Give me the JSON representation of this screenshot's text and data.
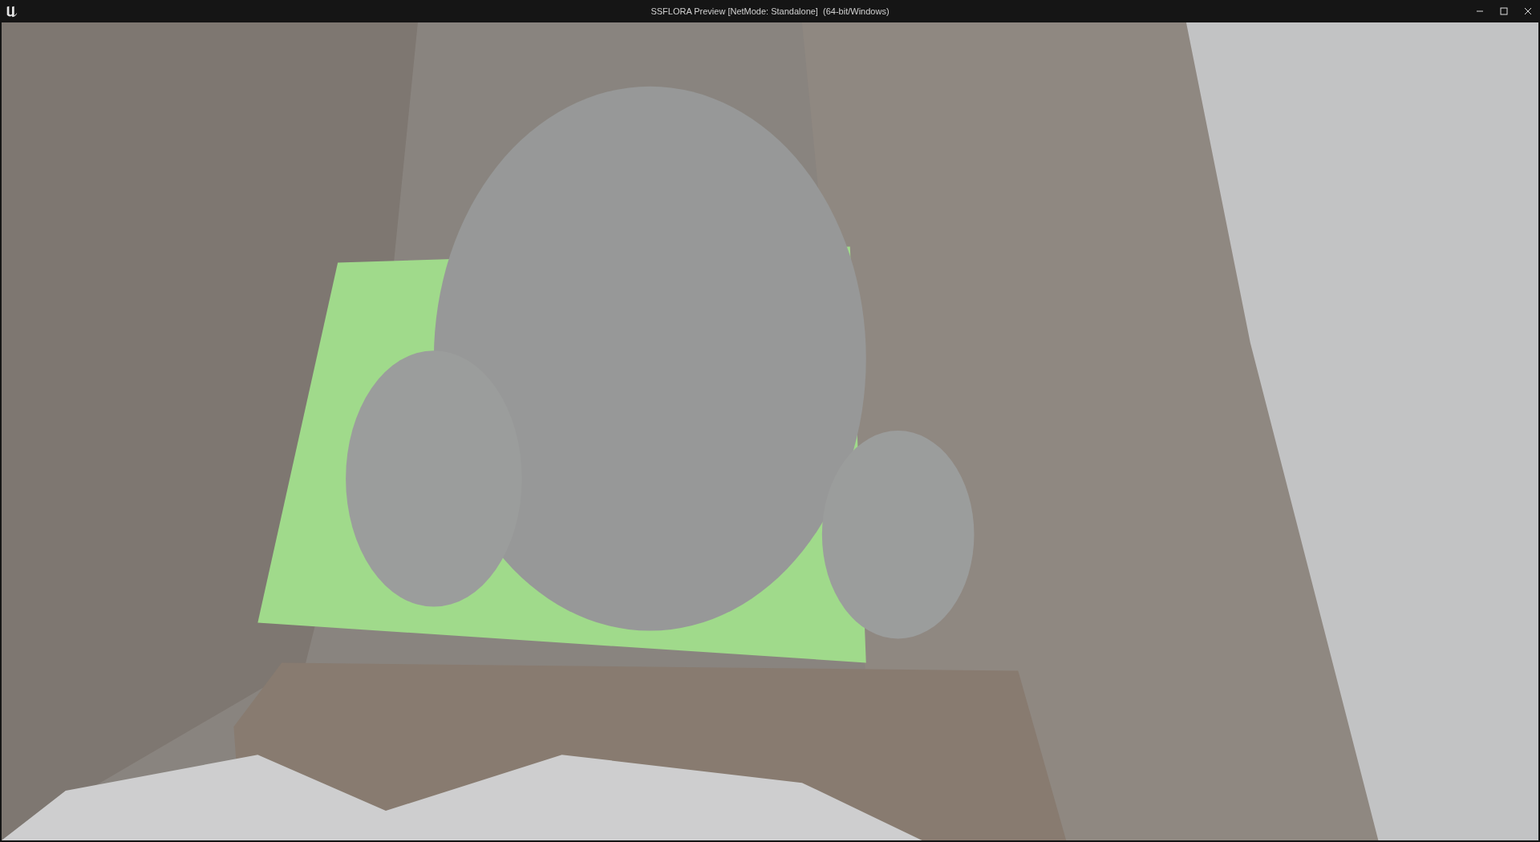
{
  "window": {
    "title": "SSFLORA Preview [NetMode: Standalone]  (64-bit/Windows)"
  }
}
